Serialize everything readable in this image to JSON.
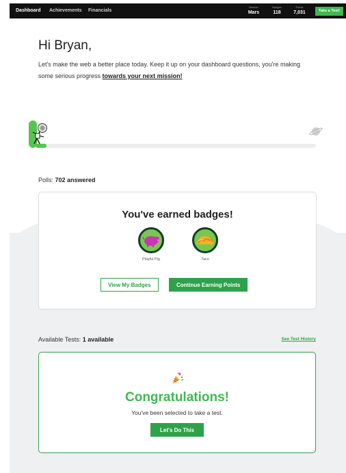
{
  "nav": {
    "items": [
      "Dashboard",
      "Achievements",
      "Financials"
    ],
    "stats": [
      {
        "label": "Mission",
        "value": "Mars"
      },
      {
        "label": "Badges",
        "value": "118"
      },
      {
        "label": "Points",
        "value": "7,031"
      }
    ],
    "cta": "Take a Test!"
  },
  "hero": {
    "greeting": "Hi Bryan,",
    "intro": "Let's make the web a better place today. Keep it up on your dashboard questions, you're making some serious progress ",
    "intro_link": "towards your next mission!"
  },
  "progress": {
    "fraction": 0.04,
    "start_icon": "astronaut-icon",
    "end_icon": "planet-icon"
  },
  "polls": {
    "label": "Polls: ",
    "value": "702 answered"
  },
  "badges": {
    "title": "You've earned badges!",
    "items": [
      {
        "label": "Playful Pig",
        "icon": "pig-icon"
      },
      {
        "label": "Taco",
        "icon": "taco-icon"
      }
    ],
    "view_button": "View My Badges",
    "continue_button": "Continue Earning Points"
  },
  "tests": {
    "label": "Available Tests: ",
    "value": "1 available",
    "history_link": "See Test History"
  },
  "congrats": {
    "icon": "party-popper-icon",
    "title": "Congratulations!",
    "subtitle": "You've been selected to take a test.",
    "button": "Let's Do This"
  },
  "colors": {
    "accent": "#2ea24b",
    "accent_light": "#3fb950",
    "nav_bg": "#111111",
    "band_bg": "#eef0f2"
  }
}
